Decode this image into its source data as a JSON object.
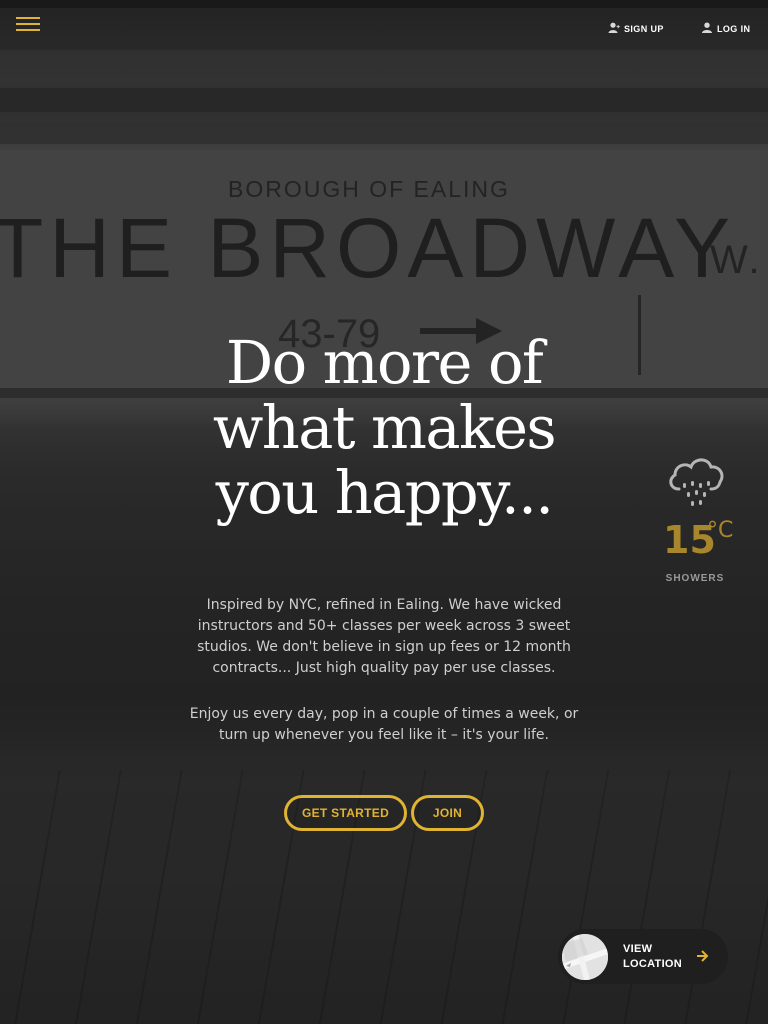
{
  "header": {
    "menu_icon": "hamburger-menu-icon",
    "signup_label": "SIGN UP",
    "signup_icon": "add-user-icon",
    "login_label": "LOG IN",
    "login_icon": "user-icon"
  },
  "background": {
    "sign_top_text": "BOROUGH OF EALING",
    "sign_main_text": "THE BROADWAY",
    "sign_suffix_text": "W.",
    "sign_number_text": "43-79"
  },
  "hero": {
    "title_line1": "Do more of",
    "title_line2": "what makes",
    "title_line3": "you happy...",
    "paragraph1": "Inspired by NYC, refined in Ealing.  We have wicked instructors and 50+ classes per week across 3 sweet studios.  We don't believe in sign up fees or 12 month contracts...  Just high quality pay per use classes.",
    "paragraph2": "Enjoy us every day, pop in a couple of times a week, or turn up whenever you feel like it – it's your life.",
    "get_started_label": "GET STARTED",
    "join_label": "JOIN"
  },
  "weather": {
    "icon": "rain-cloud-icon",
    "temperature": "15",
    "unit": "°C",
    "condition": "SHOWERS"
  },
  "location": {
    "label_line1": "VIEW",
    "label_line2": "LOCATION",
    "icon": "arrow-right-icon"
  },
  "colors": {
    "accent": "#e1b332",
    "temperature": "#a8862c",
    "text": "#ffffff",
    "muted": "#cfcfcf"
  }
}
